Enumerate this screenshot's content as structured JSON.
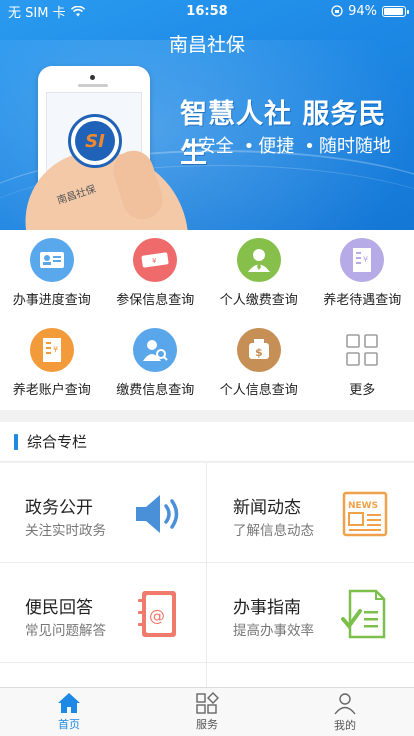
{
  "status_bar": {
    "carrier": "无 SIM 卡",
    "time": "16:58",
    "battery": "94%",
    "battery_level": 0.94
  },
  "app_title": "南昌社保",
  "banner": {
    "slogan": "智慧人社 服务民生",
    "tags": [
      "安全",
      "便捷",
      "随时随地"
    ],
    "phone_text": "南昌社保",
    "logo_text": "SI"
  },
  "services": [
    {
      "label": "办事进度查询",
      "icon": "id-card-icon",
      "color": "#58a7ec"
    },
    {
      "label": "参保信息查询",
      "icon": "ticket-icon",
      "color": "#ef6b6b"
    },
    {
      "label": "个人缴费查询",
      "icon": "person-icon",
      "color": "#86c04a"
    },
    {
      "label": "养老待遇查询",
      "icon": "receipt-icon",
      "color": "#b5a9e6"
    },
    {
      "label": "养老账户查询",
      "icon": "account-book-icon",
      "color": "#f39b3a"
    },
    {
      "label": "缴费信息查询",
      "icon": "user-search-icon",
      "color": "#5aa6ea"
    },
    {
      "label": "个人信息查询",
      "icon": "money-bag-icon",
      "color": "#c58f55"
    },
    {
      "label": "更多",
      "icon": "grid-icon",
      "color": "#9e9e9e"
    }
  ],
  "section": {
    "title": "综合专栏"
  },
  "cards": [
    {
      "title": "政务公开",
      "subtitle": "关注实时政务",
      "icon": "speaker-icon"
    },
    {
      "title": "新闻动态",
      "subtitle": "了解信息动态",
      "icon": "newspaper-icon",
      "icon_text": "NEWS"
    },
    {
      "title": "便民回答",
      "subtitle": "常见问题解答",
      "icon": "address-book-icon"
    },
    {
      "title": "办事指南",
      "subtitle": "提高办事效率",
      "icon": "checklist-icon"
    }
  ],
  "tabbar": [
    {
      "label": "首页",
      "icon": "home-icon",
      "active": true
    },
    {
      "label": "服务",
      "icon": "services-icon",
      "active": false
    },
    {
      "label": "我的",
      "icon": "profile-icon",
      "active": false
    }
  ],
  "colors": {
    "accent": "#1e88e5",
    "banner": "#1e8ae6",
    "icon_orange": "#f0a24a",
    "icon_green": "#7cc04b",
    "icon_blue": "#4a90d9"
  }
}
